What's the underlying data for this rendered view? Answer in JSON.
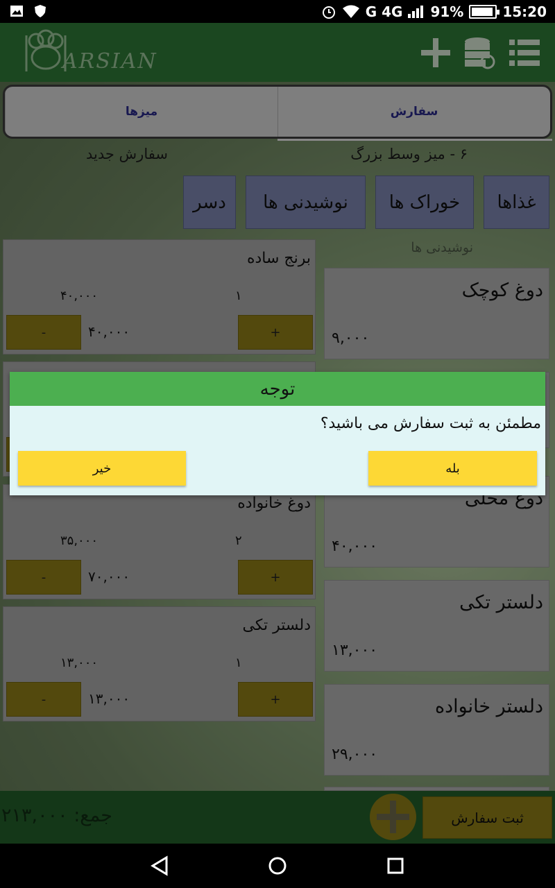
{
  "status_bar": {
    "network_label": "G 4G",
    "battery_percent": "91%",
    "time": "15:20"
  },
  "app_bar": {
    "logo_text": "ARSIAN",
    "icons": [
      "add-icon",
      "database-sync-icon",
      "menu-list-icon"
    ]
  },
  "tabs": [
    {
      "label": "سفارش"
    },
    {
      "label": "میزها"
    }
  ],
  "order_info": {
    "table": "۶ - میز وسط بزرگ",
    "status": "سفارش جدید"
  },
  "categories": [
    {
      "label": "غذاها"
    },
    {
      "label": "خوراک ها"
    },
    {
      "label": "نوشیدنی ها"
    },
    {
      "label": "دسر"
    }
  ],
  "section_label": "نوشیدنی ها",
  "order_items": [
    {
      "name": "برنج ساده",
      "unit_price": "۴۰,۰۰۰",
      "quantity": "۱",
      "total": "۴۰,۰۰۰",
      "minus": "-",
      "plus": "+"
    },
    {
      "name": "",
      "unit_price": "",
      "quantity": "",
      "total": "",
      "minus": "-",
      "plus": "+"
    },
    {
      "name": "دوغ خانواده",
      "unit_price": "۳۵,۰۰۰",
      "quantity": "۲",
      "total": "۷۰,۰۰۰",
      "minus": "-",
      "plus": "+"
    },
    {
      "name": "دلستر تکی",
      "unit_price": "۱۳,۰۰۰",
      "quantity": "۱",
      "total": "۱۳,۰۰۰",
      "minus": "-",
      "plus": "+"
    }
  ],
  "products": [
    {
      "name": "دوغ کوچک",
      "price": "۹,۰۰۰"
    },
    {
      "name": "",
      "price": ""
    },
    {
      "name": "دوغ محلی",
      "price": "۴۰,۰۰۰"
    },
    {
      "name": "دلستر تکی",
      "price": "۱۳,۰۰۰"
    },
    {
      "name": "دلستر خانواده",
      "price": "۲۹,۰۰۰"
    }
  ],
  "bottom_bar": {
    "total_label": "جمع: ۲۱۳,۰۰۰",
    "submit_label": "ثبت سفارش"
  },
  "dialog": {
    "title": "توجه",
    "message": "مطمئن به ثبت سفارش می باشید؟",
    "yes_label": "بله",
    "no_label": "خیر"
  },
  "colors": {
    "app_bar": "#2f7a37",
    "dialog_header": "#4caf50",
    "dialog_button": "#fdd835",
    "category_button": "#7e87b1",
    "action_button": "#8f7f18"
  }
}
